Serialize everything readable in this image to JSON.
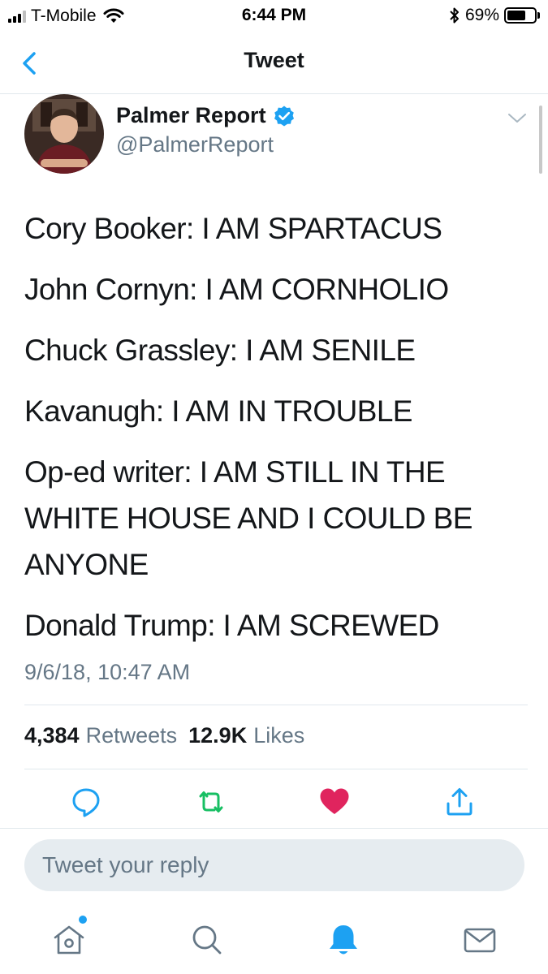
{
  "status_bar": {
    "carrier": "T-Mobile",
    "time": "6:44 PM",
    "battery_percent": "69%",
    "battery_level": 0.69,
    "signal_bars_filled": 3,
    "signal_bars_total": 4
  },
  "nav": {
    "title": "Tweet",
    "back_icon": "chevron-left-icon"
  },
  "tweet": {
    "author_name": "Palmer Report",
    "author_handle": "@PalmerReport",
    "verified": true,
    "lines": [
      "Cory Booker: I AM SPARTACUS",
      "John Cornyn: I AM CORNHOLIO",
      "Chuck Grassley: I AM SENILE",
      "Kavanugh: I AM IN TROUBLE",
      "Op-ed writer: I AM STILL IN THE WHITE HOUSE AND I COULD BE ANYONE",
      "Donald Trump: I AM SCREWED"
    ],
    "timestamp": "9/6/18, 10:47 AM",
    "retweets_count": "4,384",
    "retweets_label": "Retweets",
    "likes_count": "12.9K",
    "likes_label": "Likes"
  },
  "actions": [
    {
      "name": "reply",
      "icon": "reply-icon",
      "color": "#1da1f2"
    },
    {
      "name": "retweet",
      "icon": "retweet-icon",
      "color": "#17bf63"
    },
    {
      "name": "like",
      "icon": "heart-icon",
      "color": "#e0245e",
      "active": true
    },
    {
      "name": "share",
      "icon": "share-icon",
      "color": "#1da1f2"
    }
  ],
  "reply": {
    "placeholder": "Tweet your reply"
  },
  "tab_bar": [
    {
      "name": "home",
      "icon": "home-icon",
      "has_notification_dot": true
    },
    {
      "name": "search",
      "icon": "search-icon"
    },
    {
      "name": "notifications",
      "icon": "bell-icon",
      "active": true
    },
    {
      "name": "messages",
      "icon": "envelope-icon"
    }
  ],
  "colors": {
    "accent": "#1da1f2",
    "text_primary": "#14171a",
    "text_secondary": "#657786",
    "like": "#e0245e",
    "retweet": "#17bf63",
    "divider": "#e1e8ed"
  }
}
